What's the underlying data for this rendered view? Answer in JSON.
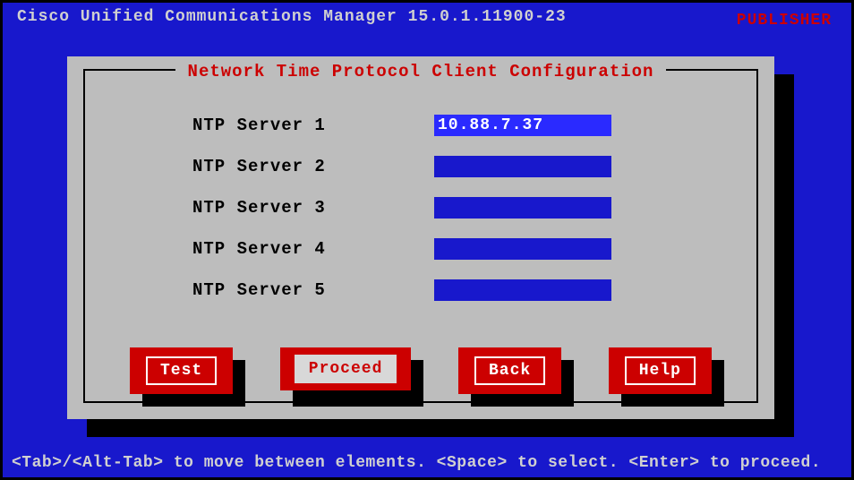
{
  "header": {
    "title": "Cisco Unified Communications Manager 15.0.1.11900-23",
    "role": "PUBLISHER"
  },
  "dialog": {
    "title": "Network Time Protocol Client Configuration",
    "fields": [
      {
        "label": "NTP Server 1",
        "value": "10.88.7.37"
      },
      {
        "label": "NTP Server 2",
        "value": ""
      },
      {
        "label": "NTP Server 3",
        "value": ""
      },
      {
        "label": "NTP Server 4",
        "value": ""
      },
      {
        "label": "NTP Server 5",
        "value": ""
      }
    ],
    "buttons": {
      "test": "Test",
      "proceed": "Proceed",
      "back": "Back",
      "help": "Help"
    },
    "selected_button": "proceed"
  },
  "footer": {
    "help_text": "<Tab>/<Alt-Tab> to move between elements. <Space> to select. <Enter> to proceed."
  }
}
